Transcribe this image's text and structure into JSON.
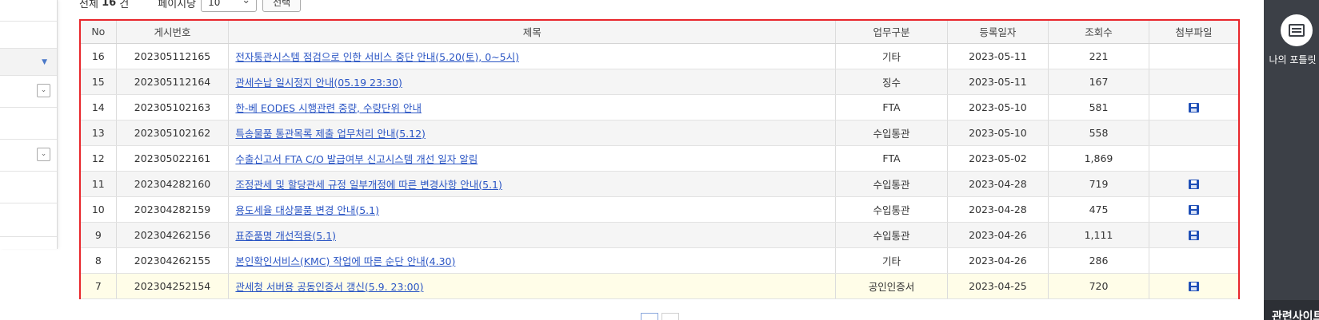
{
  "toolbar": {
    "total_prefix": "전체",
    "total_count": "16",
    "total_suffix": "건",
    "per_page_label": "페이지당",
    "per_page_value": "10",
    "select_button": "선택"
  },
  "table": {
    "headers": [
      "No",
      "게시번호",
      "제목",
      "업무구분",
      "등록일자",
      "조회수",
      "첨부파일"
    ],
    "rows": [
      {
        "no": "16",
        "post_id": "202305112165",
        "title": "전자통관시스템 점검으로 인한 서비스 중단 안내(5.20(토), 0~5시)",
        "category": "기타",
        "date": "2023-05-11",
        "views": "221",
        "attachment": false
      },
      {
        "no": "15",
        "post_id": "202305112164",
        "title": "관세수납 일시정지 안내(05.19 23:30)",
        "category": "징수",
        "date": "2023-05-11",
        "views": "167",
        "attachment": false
      },
      {
        "no": "14",
        "post_id": "202305102163",
        "title": "한-베 EODES 시행관련 중량, 수량단위 안내",
        "category": "FTA",
        "date": "2023-05-10",
        "views": "581",
        "attachment": true
      },
      {
        "no": "13",
        "post_id": "202305102162",
        "title": "특송물품 통관목록 제출 업무처리 안내(5.12)",
        "category": "수입통관",
        "date": "2023-05-10",
        "views": "558",
        "attachment": false
      },
      {
        "no": "12",
        "post_id": "202305022161",
        "title": "수출신고서 FTA C/O 발급여부 신고시스템 개선 일자 알림",
        "category": "FTA",
        "date": "2023-05-02",
        "views": "1,869",
        "attachment": false
      },
      {
        "no": "11",
        "post_id": "202304282160",
        "title": "조정관세 및 할당관세 규정 일부개정에 따른 변경사항 안내(5.1)",
        "category": "수입통관",
        "date": "2023-04-28",
        "views": "719",
        "attachment": true
      },
      {
        "no": "10",
        "post_id": "202304282159",
        "title": "용도세율 대상물품 변경 안내(5.1)",
        "category": "수입통관",
        "date": "2023-04-28",
        "views": "475",
        "attachment": true
      },
      {
        "no": "9",
        "post_id": "202304262156",
        "title": "표준품명 개선적용(5.1)",
        "category": "수입통관",
        "date": "2023-04-26",
        "views": "1,111",
        "attachment": true
      },
      {
        "no": "8",
        "post_id": "202304262155",
        "title": "본인확인서비스(KMC) 작업에 따른 순단 안내(4.30)",
        "category": "기타",
        "date": "2023-04-26",
        "views": "286",
        "attachment": false
      },
      {
        "no": "7",
        "post_id": "202304252154",
        "title": "관세청 서버용 공동인증서 갱신(5.9. 23:00)",
        "category": "공인인증서",
        "date": "2023-04-25",
        "views": "720",
        "attachment": true
      }
    ]
  },
  "right_rail": {
    "portlet_label": "나의 포틀릿",
    "bottom_label": "관련사이트"
  },
  "icons": {
    "attachment": "floppy-disk-icon",
    "portlet": "keyboard-icon"
  },
  "colors": {
    "highlight_border": "#e8262b",
    "link": "#2a55c4",
    "rail_background": "#3c4047",
    "attachment_icon": "#1f4fb7"
  }
}
